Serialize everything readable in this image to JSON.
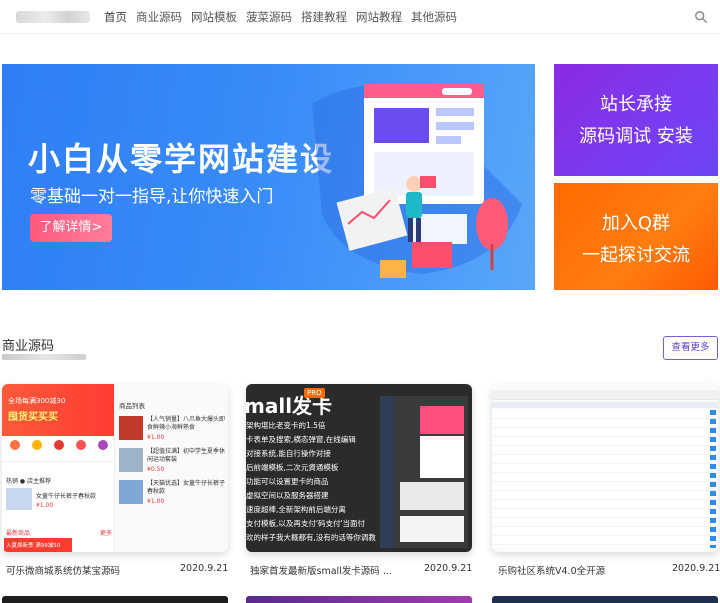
{
  "header": {
    "nav": [
      "首页",
      "商业源码",
      "网站模板",
      "菠菜源码",
      "搭建教程",
      "网站教程",
      "其他源码"
    ]
  },
  "banner": {
    "title": "小白从零学网站建设",
    "subtitle": "零基础一对一指导,让你快速入门",
    "button": "了解详情>"
  },
  "side_banners": [
    {
      "line1": "站长承接",
      "line2": "源码调试 安装"
    },
    {
      "line1": "加入Q群",
      "line2": "一起探讨交流"
    }
  ],
  "section": {
    "title": "商业源码",
    "more": "查看更多"
  },
  "cards": [
    {
      "name": "可乐微商城系统仿某宝源码",
      "date": "2020.9.21",
      "thumb": {
        "promo1": "全场每满300减30",
        "promo2": "囤货买买买",
        "list_title": "商品列表",
        "items": [
          {
            "title": "【人气销量】八爪鱼大爆头即食鲜辣小海鲜熟食",
            "price": "¥1.00"
          },
          {
            "title": "【超值拉满】初中学生夏季休闲运动套装",
            "price": "¥0.50"
          },
          {
            "title": "【天猫优选】女童牛仔长裤子春秋款",
            "price": "¥1.00"
          }
        ],
        "hot": "热销 ● 店主推荐",
        "hot_item": "女童牛仔长裤子春秋款",
        "hot_price": "¥1.00",
        "icons": [
          "天猫优选",
          "超值拉满",
          "人气销量",
          "热销",
          "其他"
        ],
        "latest": "最新商品",
        "latest_more": "更多",
        "latest_promo": "入夏焕新季 满99减50"
      }
    },
    {
      "name": "独家首发最新版small发卡源码 ...",
      "date": "2020.9.21",
      "thumb": {
        "title": "mall发卡",
        "badge": "PRO",
        "lines": [
          "架构堪比老变卡的1.5倍",
          "卡表单及搜索,横态弹窗,在线编辑",
          "对接系统,能自行操作对接",
          "后前端模板,二次元資通模板",
          "功能可以设置更卡的商品",
          "虚拟空间以及服务器搭建",
          "速度超棒,全新架构前后端分离",
          "支付模板,以及再支付'码支付'当面付",
          "欢的样子我大概都有,没有的话等你调教"
        ]
      }
    },
    {
      "name": "乐购社区系统V4.0全开源",
      "date": "2020.9.21"
    }
  ]
}
